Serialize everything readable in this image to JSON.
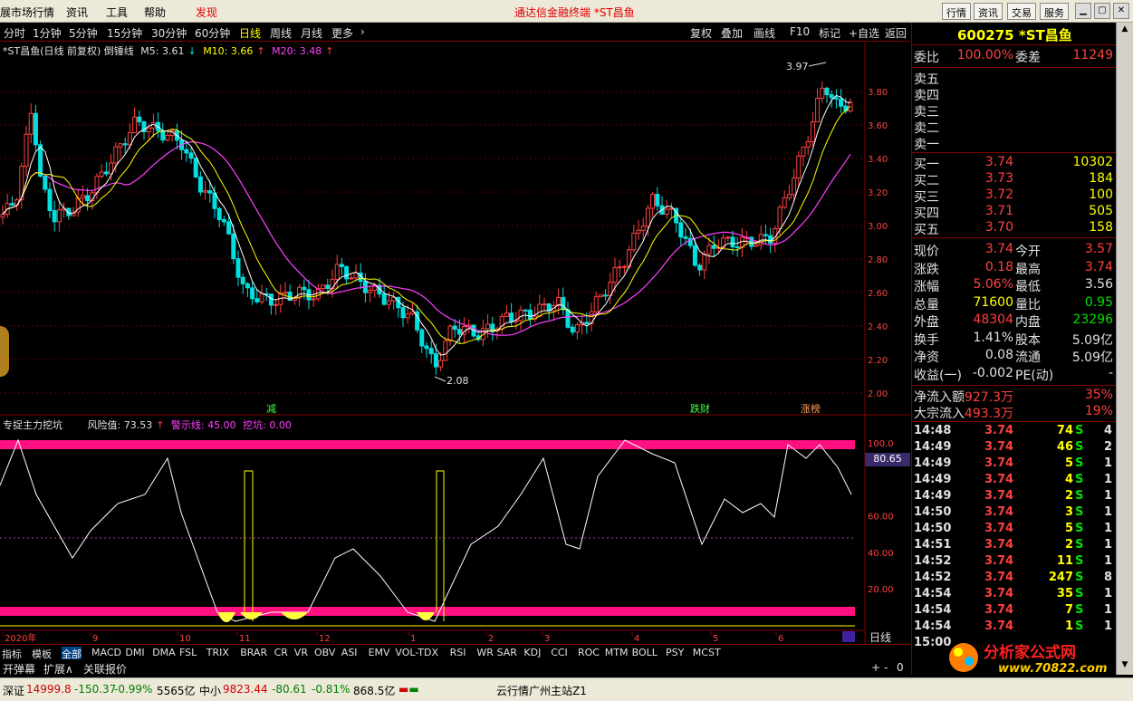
{
  "menubar": {
    "items": [
      "展市场行情",
      "资讯",
      "工具",
      "帮助",
      "发现"
    ],
    "title": "通达信金融终端  *ST昌鱼",
    "right_buttons": [
      "行情",
      "资讯",
      "交易",
      "服务"
    ]
  },
  "periods": {
    "items": [
      "分时",
      "1分钟",
      "5分钟",
      "15分钟",
      "30分钟",
      "60分钟",
      "日线",
      "周线",
      "月线",
      "更多"
    ],
    "active": "日线",
    "right_items": [
      "复权",
      "叠加",
      "画线",
      "F10",
      "标记",
      "+自选",
      "返回"
    ]
  },
  "main_legend": {
    "title": "*ST昌鱼(日线 前复权) 倒锤线",
    "m5": "M5: 3.61",
    "m10": "M10: 3.66",
    "m20": "M20: 3.48"
  },
  "price_axis": [
    "3.80",
    "3.60",
    "3.40",
    "3.20",
    "3.00",
    "2.80",
    "2.60",
    "2.40",
    "2.20",
    "2.00"
  ],
  "annotations": {
    "high": "3.97",
    "low": "2.08",
    "tag1": "减",
    "tag2": "跌财",
    "tag3": "涨榜"
  },
  "sub_legend": {
    "title": "专捉主力挖坑",
    "risk": "风险值: 73.53",
    "warn": "警示线: 45.00",
    "dig": "挖坑: 0.00"
  },
  "sub_axis": [
    "100.0",
    "80.65",
    "60.00",
    "40.00",
    "20.00"
  ],
  "date_axis": [
    "2020年",
    "9",
    "10",
    "11",
    "12",
    "1",
    "2",
    "3",
    "4",
    "5",
    "6"
  ],
  "quote": {
    "code": "600275 *ST昌鱼",
    "webi_label": "委比",
    "webi": "100.00%",
    "weicha_label": "委差",
    "weicha": "11249",
    "sell": [
      {
        "label": "卖五",
        "price": "",
        "vol": ""
      },
      {
        "label": "卖四",
        "price": "",
        "vol": ""
      },
      {
        "label": "卖三",
        "price": "",
        "vol": ""
      },
      {
        "label": "卖二",
        "price": "",
        "vol": ""
      },
      {
        "label": "卖一",
        "price": "",
        "vol": ""
      }
    ],
    "buy": [
      {
        "label": "买一",
        "price": "3.74",
        "vol": "10302"
      },
      {
        "label": "买二",
        "price": "3.73",
        "vol": "184"
      },
      {
        "label": "买三",
        "price": "3.72",
        "vol": "100"
      },
      {
        "label": "买四",
        "price": "3.71",
        "vol": "505"
      },
      {
        "label": "买五",
        "price": "3.70",
        "vol": "158"
      }
    ],
    "stats": [
      {
        "k": "现价",
        "v": "3.74",
        "vc": "red",
        "k2": "今开",
        "v2": "3.57",
        "v2c": "red"
      },
      {
        "k": "涨跌",
        "v": "0.18",
        "vc": "red",
        "k2": "最高",
        "v2": "3.74",
        "v2c": "red"
      },
      {
        "k": "涨幅",
        "v": "5.06%",
        "vc": "red",
        "k2": "最低",
        "v2": "3.56",
        "v2c": "white"
      },
      {
        "k": "总量",
        "v": "71600",
        "vc": "yellow",
        "k2": "量比",
        "v2": "0.95",
        "v2c": "green"
      },
      {
        "k": "外盘",
        "v": "48304",
        "vc": "red",
        "k2": "内盘",
        "v2": "23296",
        "v2c": "green"
      },
      {
        "k": "换手",
        "v": "1.41%",
        "vc": "white",
        "k2": "股本",
        "v2": "5.09亿",
        "v2c": "white"
      },
      {
        "k": "净资",
        "v": "0.08",
        "vc": "white",
        "k2": "流通",
        "v2": "5.09亿",
        "v2c": "white"
      },
      {
        "k": "收益(一)",
        "v": "-0.002",
        "vc": "white",
        "k2": "PE(动)",
        "v2": "-",
        "v2c": "white"
      }
    ],
    "flow": [
      {
        "k": "净流入额",
        "v": "927.3万",
        "p": "35%"
      },
      {
        "k": "大宗流入",
        "v": "493.3万",
        "p": "19%"
      }
    ],
    "ticks": [
      {
        "t": "14:48",
        "p": "3.74",
        "v": "74",
        "bs": "S",
        "n": "4"
      },
      {
        "t": "14:49",
        "p": "3.74",
        "v": "46",
        "bs": "S",
        "n": "2"
      },
      {
        "t": "14:49",
        "p": "3.74",
        "v": "5",
        "bs": "S",
        "n": "1"
      },
      {
        "t": "14:49",
        "p": "3.74",
        "v": "4",
        "bs": "S",
        "n": "1"
      },
      {
        "t": "14:49",
        "p": "3.74",
        "v": "2",
        "bs": "S",
        "n": "1"
      },
      {
        "t": "14:50",
        "p": "3.74",
        "v": "3",
        "bs": "S",
        "n": "1"
      },
      {
        "t": "14:50",
        "p": "3.74",
        "v": "5",
        "bs": "S",
        "n": "1"
      },
      {
        "t": "14:51",
        "p": "3.74",
        "v": "2",
        "bs": "S",
        "n": "1"
      },
      {
        "t": "14:52",
        "p": "3.74",
        "v": "11",
        "bs": "S",
        "n": "1"
      },
      {
        "t": "14:52",
        "p": "3.74",
        "v": "247",
        "bs": "S",
        "n": "8"
      },
      {
        "t": "14:54",
        "p": "3.74",
        "v": "35",
        "bs": "S",
        "n": "1"
      },
      {
        "t": "14:54",
        "p": "3.74",
        "v": "7",
        "bs": "S",
        "n": "1"
      },
      {
        "t": "14:54",
        "p": "3.74",
        "v": "1",
        "bs": "S",
        "n": "1"
      },
      {
        "t": "15:00",
        "p": "",
        "v": "",
        "bs": "",
        "n": ""
      }
    ]
  },
  "indicators": [
    "指标",
    "模板",
    "全部",
    "MACD",
    "DMI",
    "DMA",
    "FSL",
    "TRIX",
    "BRAR",
    "CR",
    "VR",
    "OBV",
    "ASI",
    "EMV",
    "VOL-TDX",
    "RSI",
    "WR",
    "SAR",
    "KDJ",
    "CCI",
    "ROC",
    "MTM",
    "BOLL",
    "PSY",
    "MCST"
  ],
  "options": [
    "开弹幕",
    "扩展∧",
    "关联报价"
  ],
  "day_label": "日线",
  "status": {
    "sz_label": "深证",
    "sz_val": "14999.8",
    "sz_chg": "-150.37",
    "sz_pct": "-0.99%",
    "sz_amt": "5565亿",
    "zx_label": "中小",
    "zx_val": "9823.44",
    "zx_chg": "-80.61",
    "zx_pct": "-0.81%",
    "zx_amt": "868.5亿",
    "server": "云行情广州主站Z1"
  },
  "brand": {
    "name": "分析家公式网",
    "url": "www.70822.com"
  },
  "colors": {
    "up": "#ff4040",
    "down": "#00e0e0",
    "m5": "#ffffff",
    "m10": "#ffff00",
    "m20": "#ff40ff",
    "band": "#ff1080"
  }
}
